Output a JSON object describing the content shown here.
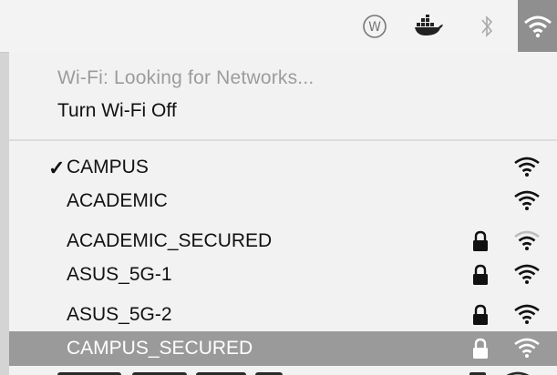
{
  "menubar": {
    "icons": [
      "w-circle-icon",
      "docker-icon",
      "bluetooth-icon",
      "wifi-icon"
    ]
  },
  "wifi_menu": {
    "status": "Wi-Fi: Looking for Networks...",
    "toggle_label": "Turn Wi-Fi Off",
    "networks": [
      {
        "name": "CAMPUS",
        "connected": true,
        "locked": false,
        "signal": "full"
      },
      {
        "name": "ACADEMIC",
        "connected": false,
        "locked": false,
        "signal": "full"
      },
      {
        "name": "ACADEMIC_SECURED",
        "connected": false,
        "locked": true,
        "signal": "weak"
      },
      {
        "name": "ASUS_5G-1",
        "connected": false,
        "locked": true,
        "signal": "full"
      },
      {
        "name": "ASUS_5G-2",
        "connected": false,
        "locked": true,
        "signal": "full"
      },
      {
        "name": "CAMPUS_SECURED",
        "connected": false,
        "locked": true,
        "signal": "full",
        "highlighted": true
      }
    ],
    "checkmark": "✓"
  },
  "colors": {
    "menubar_bg": "#f3f3f3",
    "menu_bg": "#f2f2f2",
    "highlight_bg": "#9a9a9a",
    "disabled_text": "#9c9c9c"
  }
}
